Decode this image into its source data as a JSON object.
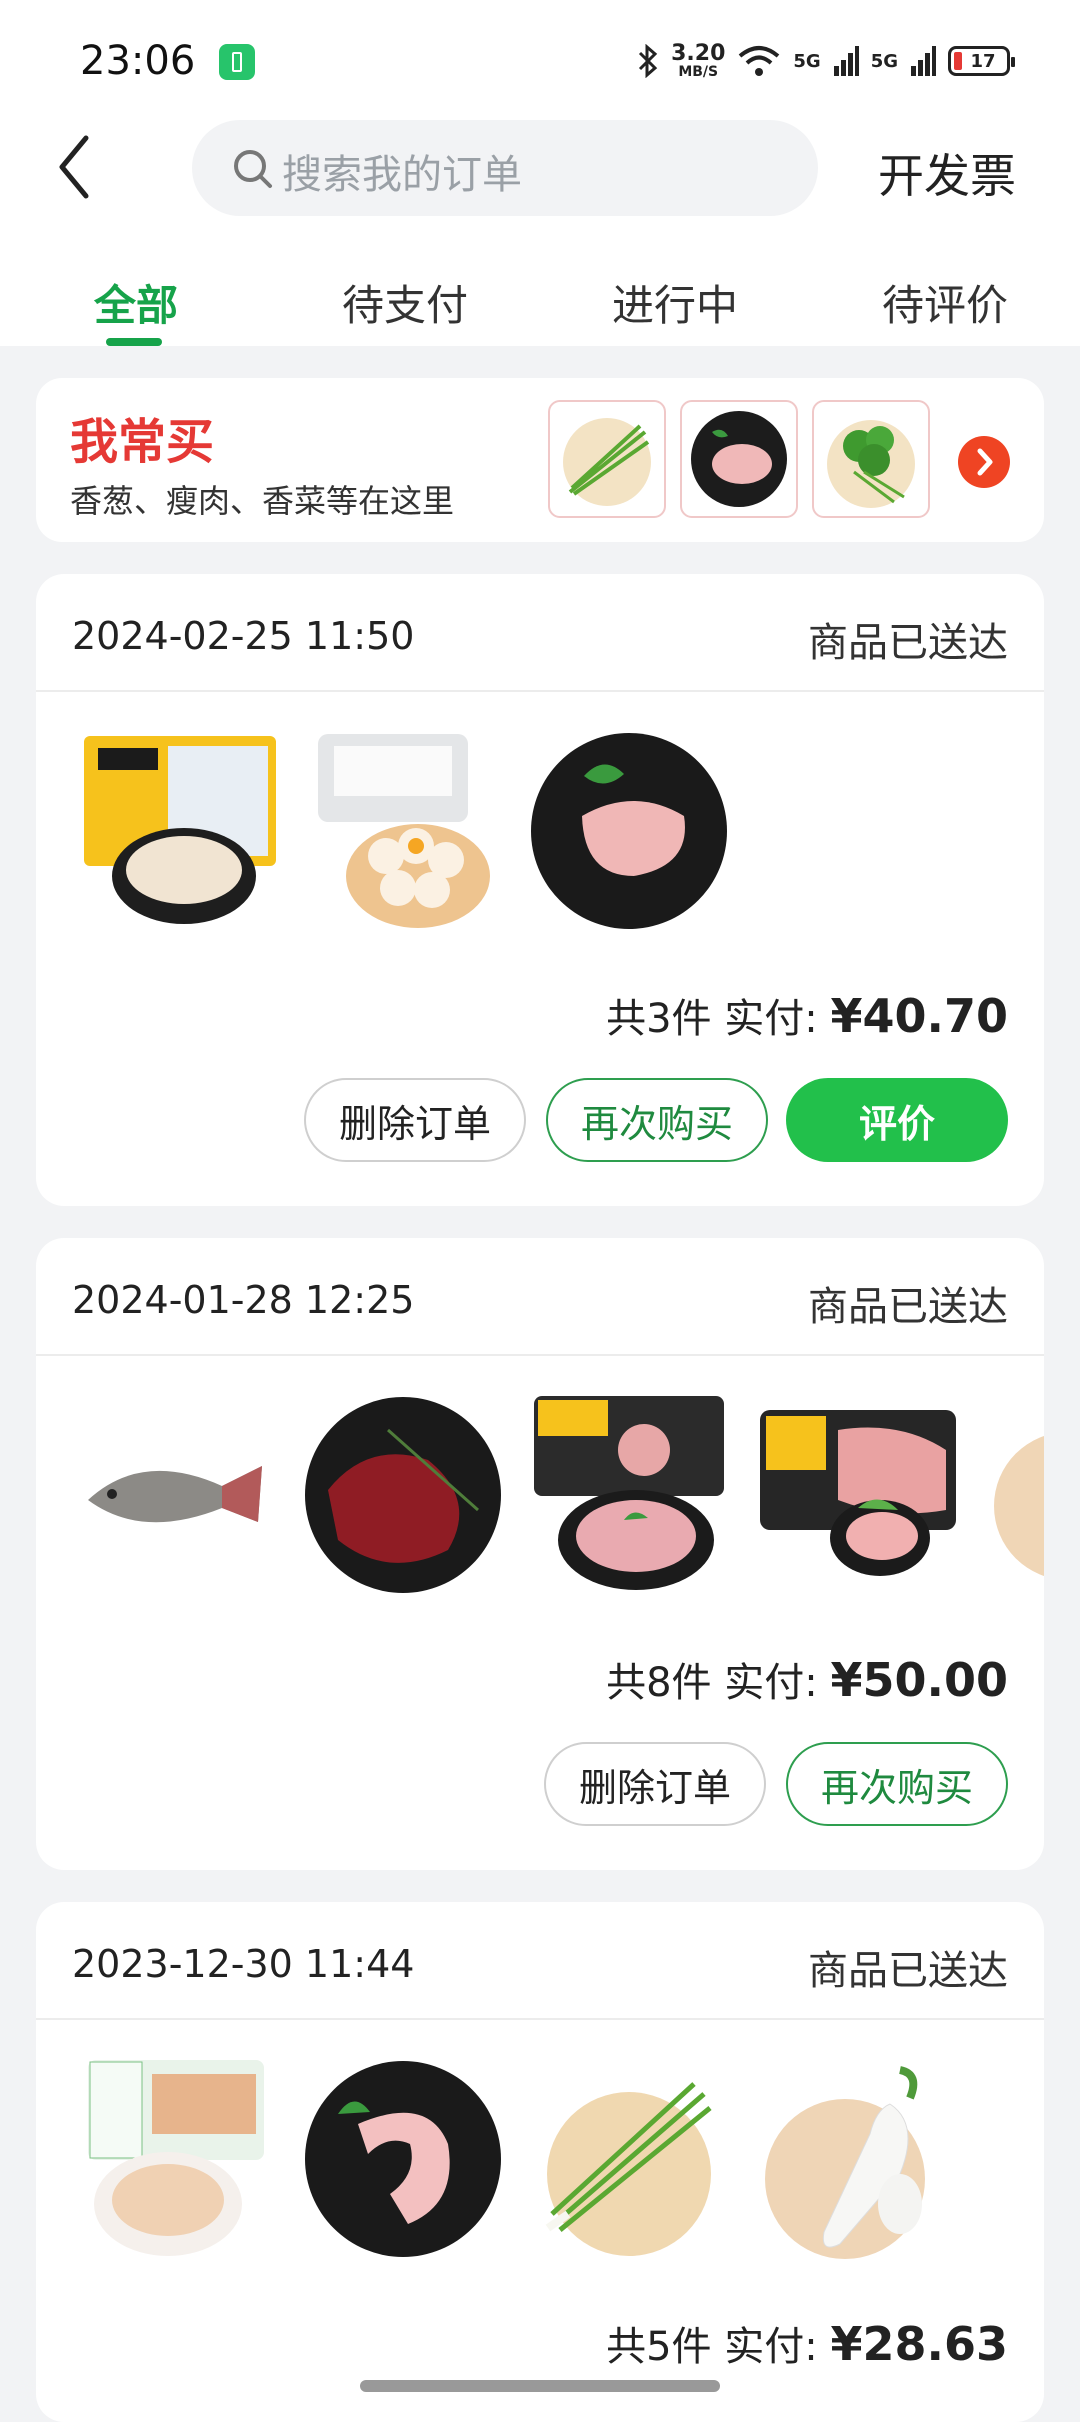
{
  "status_bar": {
    "time": "23:06",
    "network_speed": "3.20",
    "network_unit": "MB/S",
    "signal1": "5G",
    "signal2": "5G",
    "battery": "17"
  },
  "nav": {
    "search_placeholder": "搜索我的订单",
    "invoice_label": "开发票"
  },
  "tabs": [
    {
      "label": "全部",
      "active": true
    },
    {
      "label": "待支付",
      "active": false
    },
    {
      "label": "进行中",
      "active": false
    },
    {
      "label": "待评价",
      "active": false
    }
  ],
  "frequent": {
    "title": "我常买",
    "subtitle": "香葱、瘦肉、香菜等在这里",
    "thumbs": [
      "scallion",
      "lean-pork",
      "cilantro"
    ]
  },
  "orders": [
    {
      "date": "2024-02-25 11:50",
      "status": "商品已送达",
      "items": [
        "chicken-wings-pack",
        "egg-carton",
        "pork-on-plate"
      ],
      "count_text": "共3件",
      "paid_label": "实付:",
      "price": "¥40.70",
      "buttons": {
        "delete": "删除订单",
        "rebuy": "再次购买",
        "review": "评价"
      }
    },
    {
      "date": "2024-01-28 12:25",
      "status": "商品已送达",
      "items": [
        "tilapia-fish",
        "beef-slices",
        "pork-cubes-pack",
        "pork-loin-pack"
      ],
      "count_text": "共8件",
      "paid_label": "实付:",
      "price": "¥50.00",
      "buttons": {
        "delete": "删除订单",
        "rebuy": "再次购买"
      }
    },
    {
      "date": "2023-12-30 11:44",
      "status": "商品已送达",
      "items": [
        "chicken-pack",
        "pork-belly",
        "scallion",
        "white-radish"
      ],
      "count_text": "共5件",
      "paid_label": "实付:",
      "price": "¥28.63"
    }
  ],
  "colors": {
    "accent_green": "#16a34a",
    "button_green": "#22c04b",
    "title_red": "#e53935",
    "page_bg": "#f2f3f5"
  }
}
